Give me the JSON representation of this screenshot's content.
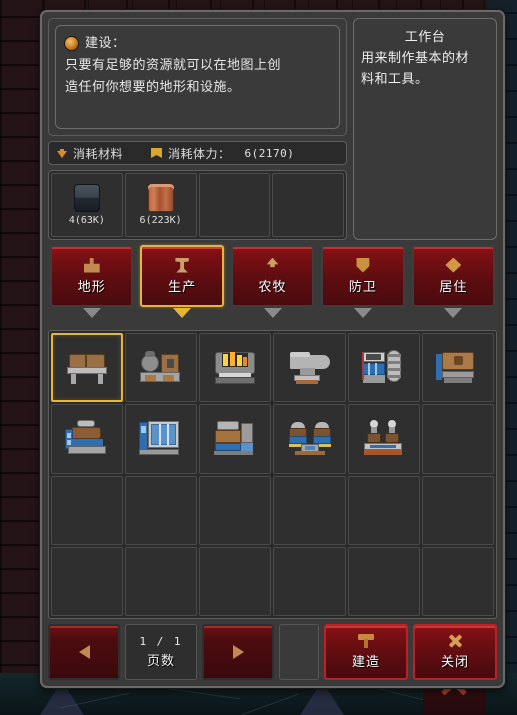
{
  "dialog": {
    "description": {
      "icon": "gem-icon",
      "title": "建设：",
      "line1": "只要有足够的资源就可以在地图上创",
      "line2": "造任何你想要的地形和设施。"
    },
    "cost": {
      "material_icon": "arrow-down-icon",
      "material_label": "消耗材料",
      "stamina_icon": "flag-icon",
      "stamina_label": "消耗体力：",
      "stamina_value": "6(2170)"
    },
    "materials": [
      {
        "icon": "stone-block",
        "count": "4(63K)"
      },
      {
        "icon": "wood-log",
        "count": "6(223K)"
      },
      {
        "icon": "",
        "count": ""
      },
      {
        "icon": "",
        "count": ""
      }
    ],
    "detail": {
      "title": "工作台",
      "line1": "用来制作基本的材",
      "line2": "料和工具。"
    },
    "tabs": [
      {
        "label": "地形",
        "icon": "terrain-icon",
        "selected": false
      },
      {
        "label": "生产",
        "icon": "anvil-icon",
        "selected": true
      },
      {
        "label": "农牧",
        "icon": "tree-icon",
        "selected": false
      },
      {
        "label": "防卫",
        "icon": "shield-icon",
        "selected": false
      },
      {
        "label": "居住",
        "icon": "diamond-icon",
        "selected": false
      }
    ],
    "grid": {
      "columns": 6,
      "rows": 4,
      "items": [
        {
          "slot": 0,
          "name": "workbench",
          "selected": true
        },
        {
          "slot": 1,
          "name": "grinder-station",
          "selected": false
        },
        {
          "slot": 2,
          "name": "furnace",
          "selected": false
        },
        {
          "slot": 3,
          "name": "anvil",
          "selected": false
        },
        {
          "slot": 4,
          "name": "loom",
          "selected": false
        },
        {
          "slot": 5,
          "name": "carpentry-bench",
          "selected": false
        },
        {
          "slot": 6,
          "name": "kiln",
          "selected": false
        },
        {
          "slot": 7,
          "name": "cabinet",
          "selected": false
        },
        {
          "slot": 8,
          "name": "press",
          "selected": false
        },
        {
          "slot": 9,
          "name": "brewery",
          "selected": false
        },
        {
          "slot": 10,
          "name": "distillery",
          "selected": false
        }
      ]
    },
    "footer": {
      "prev_label": "",
      "prev_icon": "arrow-left-icon",
      "page_number": "1 / 1",
      "page_label": "页数",
      "next_label": "",
      "next_icon": "arrow-right-icon",
      "build_label": "建造",
      "build_icon": "hammer-icon",
      "close_label": "关闭",
      "close_icon": "x-icon"
    }
  },
  "colors": {
    "panel_bg": "#3a3a3a",
    "panel_border": "#6a6a6a",
    "tab_red": "#7b1014",
    "accent_gold": "#e6b53c",
    "button_red_border": "#bc2127",
    "slot_bg": "#2f2f2f"
  }
}
